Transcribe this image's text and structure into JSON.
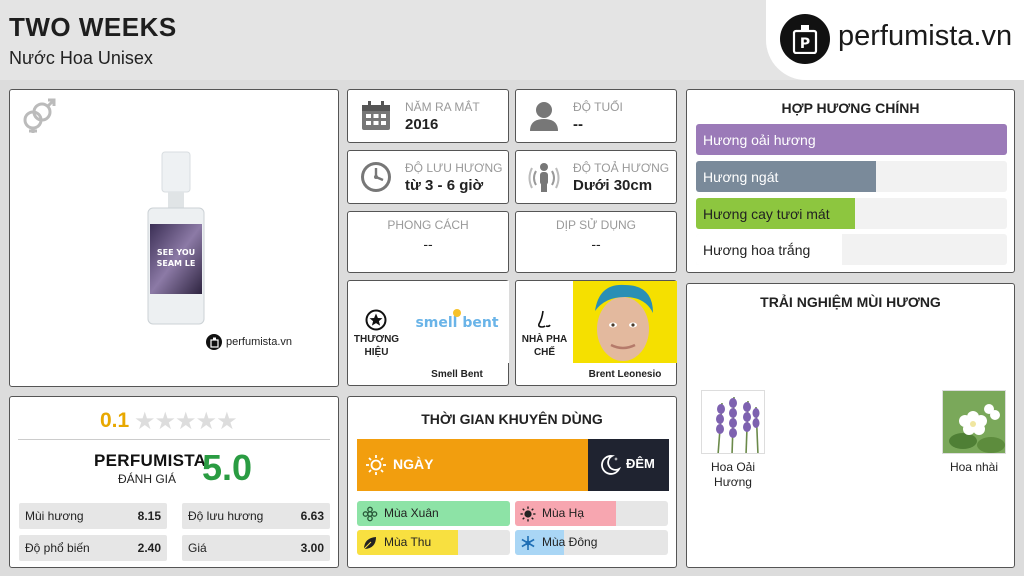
{
  "header": {
    "title": "TWO WEEKS",
    "subtitle": "Nước Hoa Unisex",
    "logo_text": "perfumista.vn"
  },
  "product": {
    "bottle_label_line1": "SEE YOU",
    "bottle_label_line2": "SEAM LE",
    "watermark": "perfumista.vn"
  },
  "info": {
    "year": {
      "label": "NĂM RA MẮT",
      "value": "2016"
    },
    "age": {
      "label": "ĐỘ TUỔI",
      "value": "--"
    },
    "longevity": {
      "label": "ĐỘ LƯU HƯƠNG",
      "value": "từ 3 - 6 giờ"
    },
    "sillage": {
      "label": "ĐỘ TOẢ HƯƠNG",
      "value": "Dưới 30cm"
    },
    "style": {
      "label": "PHONG CÁCH",
      "value": "--"
    },
    "occasion": {
      "label": "DỊP SỬ DỤNG",
      "value": "--"
    },
    "brand": {
      "label_line1": "THƯƠNG",
      "label_line2": "HIỆU",
      "logo_text": "smell bent",
      "name": "Smell Bent"
    },
    "perfumer": {
      "label_line1": "NHÀ PHA",
      "label_line2": "CHẾ",
      "name": "Brent Leonesio"
    }
  },
  "accords": {
    "title": "HỢP HƯƠNG CHÍNH",
    "items": [
      {
        "label": "Hương oải hương",
        "pct": 100,
        "color": "#9b7ab8",
        "text_color": "#ffffff"
      },
      {
        "label": "Hương ngát",
        "pct": 58,
        "color": "#7a8a9a",
        "text_color": "#ffffff"
      },
      {
        "label": "Hương cay tươi mát",
        "pct": 51,
        "color": "#8dc63f",
        "text_color": "#222222"
      },
      {
        "label": "Hương hoa trắng",
        "pct": 47,
        "color": "#ffffff",
        "text_color": "#222222"
      }
    ]
  },
  "experience": {
    "title": "TRẢI NGHIỆM MÙI HƯƠNG",
    "notes": [
      {
        "name_line1": "Hoa Oải",
        "name_line2": "Hương"
      },
      {
        "name_line1": "Hoa nhài",
        "name_line2": ""
      }
    ]
  },
  "rating": {
    "user_score": "0.1",
    "stars": "★★★★★",
    "stars_filled": 0,
    "perfumista_label": "PERFUMISTA",
    "perfumista_sub": "ĐÁNH GIÁ",
    "perfumista_score": "5.0",
    "stats": [
      {
        "label": "Mùi hương",
        "value": "8.15"
      },
      {
        "label": "Độ lưu hương",
        "value": "6.63"
      },
      {
        "label": "Độ phổ biến",
        "value": "2.40"
      },
      {
        "label": "Giá",
        "value": "3.00"
      }
    ]
  },
  "time": {
    "title": "THỜI GIAN KHUYÊN DÙNG",
    "day_label": "NGÀY",
    "night_label": "ĐÊM",
    "day_pct": 74,
    "seasons": [
      {
        "label": "Mùa Xuân",
        "pct": 100,
        "color": "#8de3a6"
      },
      {
        "label": "Mùa Hạ",
        "pct": 66,
        "color": "#f7a6b0"
      },
      {
        "label": "Mùa Thu",
        "pct": 66,
        "color": "#f8e040"
      },
      {
        "label": "Mùa Đông",
        "pct": 32,
        "color": "#a9d6f5"
      }
    ]
  },
  "colors": {
    "accent_orange": "#f29e0e",
    "night_dark": "#1f2330",
    "score_green": "#2a9c42",
    "score_yellow": "#e8a800"
  }
}
